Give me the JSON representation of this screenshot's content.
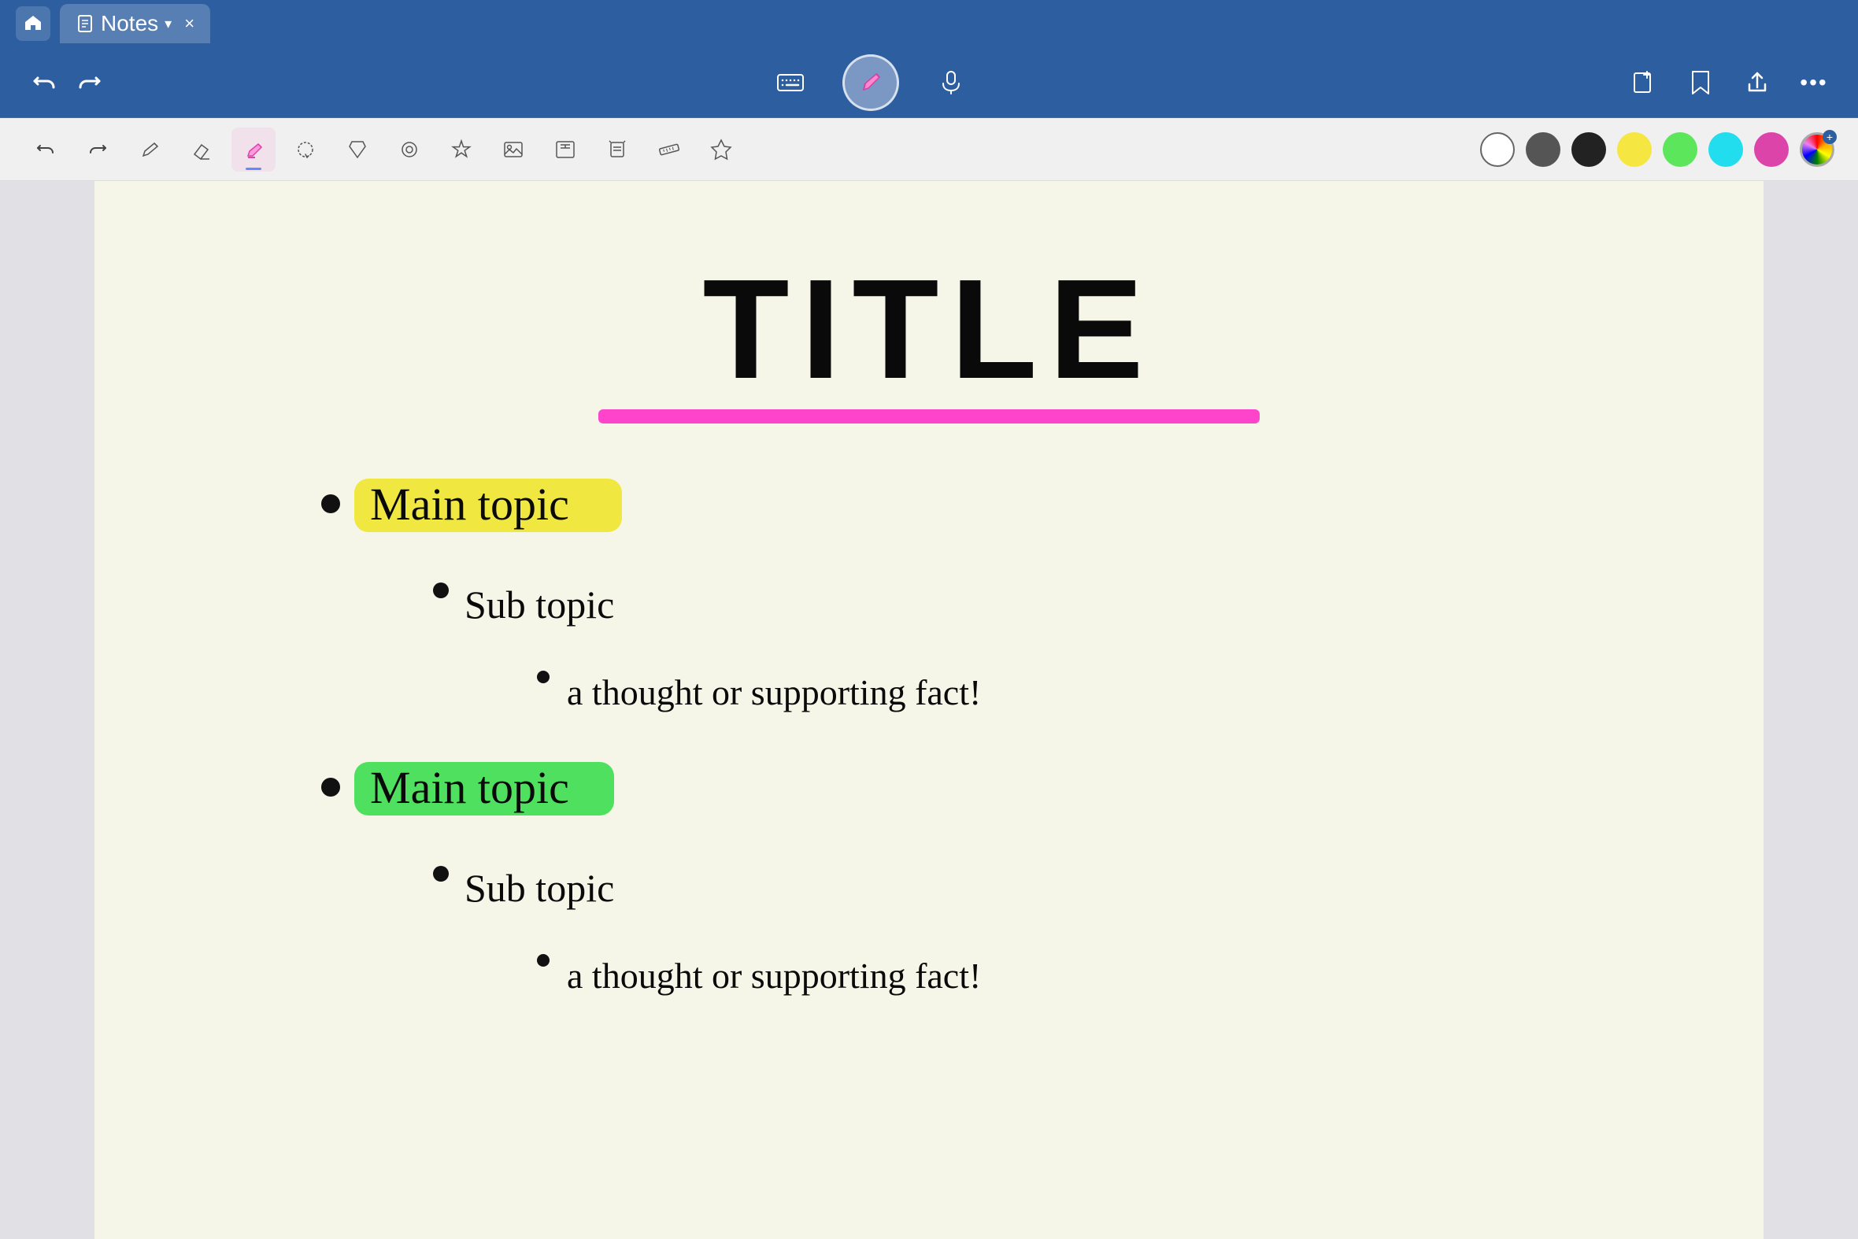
{
  "app": {
    "title": "Notes",
    "tab": {
      "label": "Notes",
      "has_dropdown": true,
      "close_label": "×"
    }
  },
  "toolbar_top": {
    "undo_label": "←",
    "redo_label": "→",
    "pencil_center_label": "✏",
    "keyboard_label": "⌨",
    "mic_label": "🎤",
    "new_page_label": "+",
    "bookmark_label": "🔖",
    "share_label": "↑",
    "more_label": "..."
  },
  "drawing_tools": [
    {
      "name": "pen",
      "icon": "✏",
      "active": false
    },
    {
      "name": "eraser",
      "icon": "◻",
      "active": false
    },
    {
      "name": "highlighter",
      "icon": "✏",
      "active": true
    },
    {
      "name": "lasso",
      "icon": "○",
      "active": false
    },
    {
      "name": "select",
      "icon": "⬡",
      "active": false
    },
    {
      "name": "loop",
      "icon": "◎",
      "active": false
    },
    {
      "name": "star",
      "icon": "★",
      "active": false
    },
    {
      "name": "image",
      "icon": "⬜",
      "active": false
    },
    {
      "name": "text",
      "icon": "T",
      "active": false
    },
    {
      "name": "scan",
      "icon": "⬡",
      "active": false
    },
    {
      "name": "ruler",
      "icon": "📐",
      "active": false
    },
    {
      "name": "more-draw",
      "icon": "✦",
      "active": false
    }
  ],
  "colors": [
    {
      "name": "white",
      "value": "#ffffff",
      "selected": true
    },
    {
      "name": "dark-gray",
      "value": "#555555",
      "selected": false
    },
    {
      "name": "black",
      "value": "#222222",
      "selected": false
    },
    {
      "name": "yellow",
      "value": "#f5e642",
      "selected": false
    },
    {
      "name": "green",
      "value": "#5ce65c",
      "selected": false
    },
    {
      "name": "cyan",
      "value": "#22ddee",
      "selected": false
    },
    {
      "name": "pink",
      "value": "#dd44aa",
      "selected": false
    }
  ],
  "canvas": {
    "background": "#f5f5e8",
    "title": "TITLE",
    "title_underline_color": "#ff44cc",
    "sections": [
      {
        "type": "main-topic",
        "text": "Main topic",
        "highlight": "yellow",
        "children": [
          {
            "type": "sub-topic",
            "text": "Sub topic",
            "children": [
              {
                "type": "sub-sub-topic",
                "text": "a thought or supporting fact!"
              }
            ]
          }
        ]
      },
      {
        "type": "main-topic",
        "text": "Main topic",
        "highlight": "green",
        "children": [
          {
            "type": "sub-topic",
            "text": "Sub topic",
            "children": [
              {
                "type": "sub-sub-topic",
                "text": "a thought or supporting fact!"
              }
            ]
          }
        ]
      }
    ]
  }
}
